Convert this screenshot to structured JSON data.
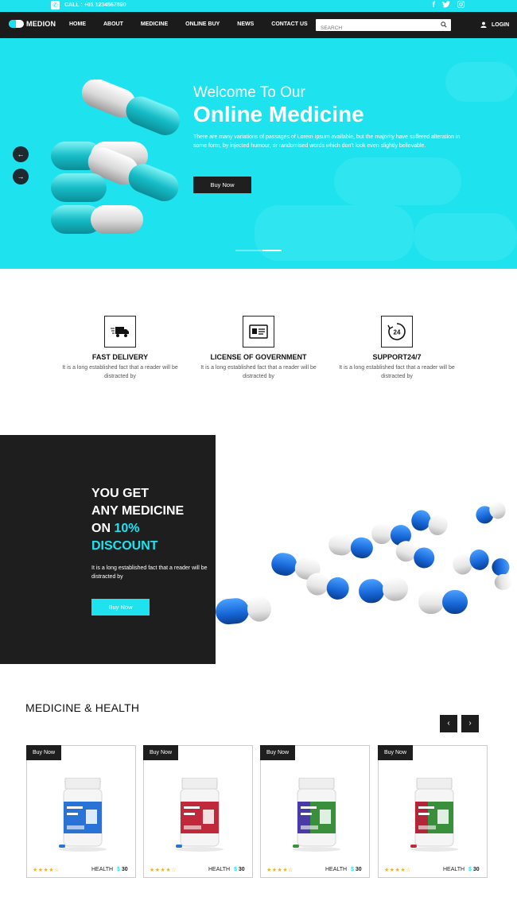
{
  "topbar": {
    "phone_label": "CALL : +01 1234567890",
    "social_icons": [
      "facebook-icon",
      "twitter-icon",
      "instagram-icon"
    ]
  },
  "nav": {
    "logo": "MEDION",
    "menu": [
      "HOME",
      "ABOUT",
      "MEDICINE",
      "ONLINE BUY",
      "NEWS",
      "CONTACT US"
    ],
    "search_placeholder": "SEARCH",
    "login_label": "LOGIN"
  },
  "hero": {
    "welcome": "Welcome To Our",
    "title": "Online Medicine",
    "description": "There are many variations of passages of Lorem Ipsum available, but the majority have suffered alteration in some form, by injected humour, or randomised words which don't look even slightly believable.",
    "button": "Buy Now"
  },
  "features": [
    {
      "title": "FAST DELIVERY",
      "desc": "It is a long established fact that a reader will be distracted by",
      "icon": "truck-icon"
    },
    {
      "title": "LICENSE OF GOVERNMENT",
      "desc": "It is a long established fact that a reader will be distracted by",
      "icon": "license-icon"
    },
    {
      "title": "SUPPORT24/7",
      "desc": "It is a long established fact that a reader will be distracted by",
      "icon": "support-24-icon"
    }
  ],
  "promo": {
    "line1": "YOU GET",
    "line2": "ANY MEDICINE",
    "line3_prefix": "ON ",
    "line3_highlight": "10%",
    "line4": "DISCOUNT",
    "description": "It is a long established fact that a reader will be distracted by",
    "button": "Buy Now"
  },
  "products": {
    "section_title": "MEDICINE & HEALTH",
    "cards": [
      {
        "buy": "Buy Now",
        "category": "HEALTH",
        "currency": "$",
        "price": "30",
        "rating": 4,
        "stars": "★★★★☆",
        "label_color": "#2a73d6"
      },
      {
        "buy": "Buy Now",
        "category": "HEALTH",
        "currency": "$",
        "price": "30",
        "rating": 4,
        "stars": "★★★★☆",
        "label_color": "#c0283b"
      },
      {
        "buy": "Buy Now",
        "category": "HEALTH",
        "currency": "$",
        "price": "30",
        "rating": 4,
        "stars": "★★★★☆",
        "label_color": "#3a8f3d"
      },
      {
        "buy": "Buy Now",
        "category": "HEALTH",
        "currency": "$",
        "price": "30",
        "rating": 4,
        "stars": "★★★★☆",
        "label_color": "#3a8f3d"
      }
    ]
  },
  "colors": {
    "accent": "#1ee3ee",
    "dark": "#1e1e1e"
  }
}
